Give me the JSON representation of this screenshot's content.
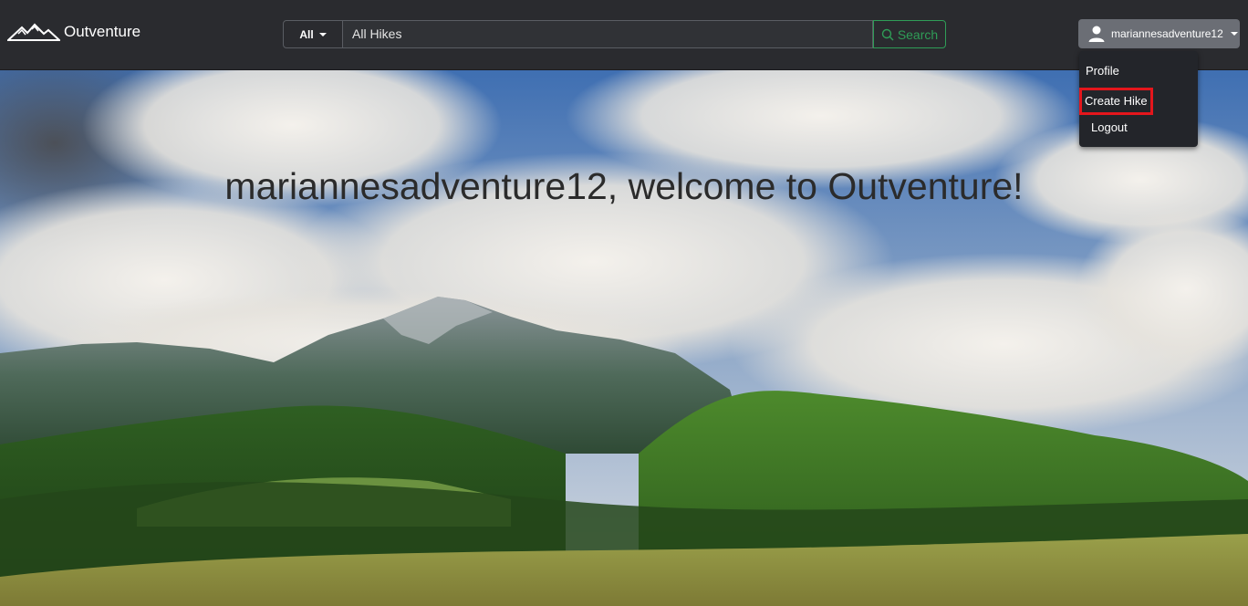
{
  "navbar": {
    "brand": "Outventure",
    "search": {
      "category": "All",
      "value": "All Hikes",
      "button_label": "Search"
    },
    "user": {
      "username": "mariannesadventure12"
    }
  },
  "dropdown": {
    "items": [
      {
        "label": "Profile"
      },
      {
        "label": "Create Hike"
      },
      {
        "label": "Logout"
      }
    ]
  },
  "hero": {
    "welcome": "mariannesadventure12, welcome to Outventure!"
  },
  "colors": {
    "navbar": "#2a2b2f",
    "search_accent": "#2f9d57",
    "highlight": "#e4161c"
  }
}
